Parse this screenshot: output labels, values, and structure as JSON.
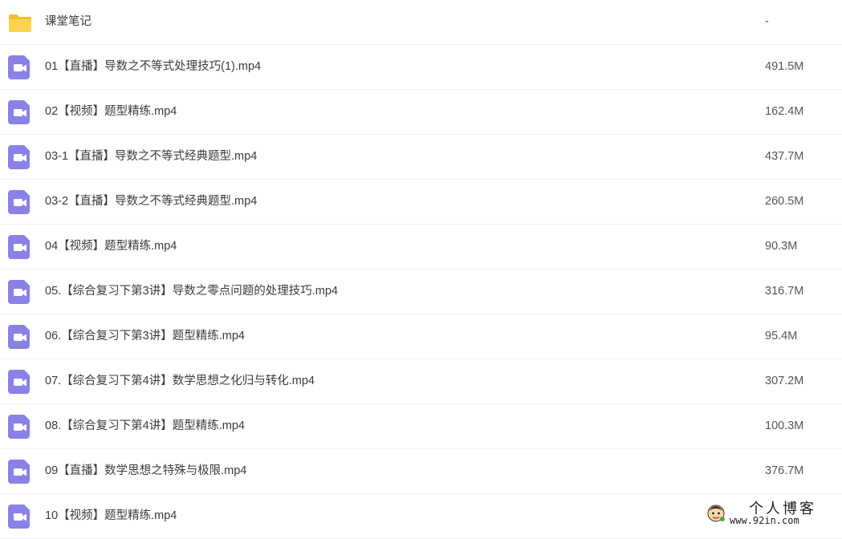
{
  "colors": {
    "folder_icon": "#FFD34F",
    "folder_icon_tab": "#F5BE2E",
    "video_icon": "#8A81E6",
    "row_divider": "#F0F0F2"
  },
  "files": [
    {
      "name": "课堂笔记",
      "size": "-",
      "icon": "folder-icon"
    },
    {
      "name": "01【直播】导数之不等式处理技巧(1).mp4",
      "size": "491.5M",
      "icon": "video-file-icon"
    },
    {
      "name": "02【视频】题型精练.mp4",
      "size": "162.4M",
      "icon": "video-file-icon"
    },
    {
      "name": "03-1【直播】导数之不等式经典题型.mp4",
      "size": "437.7M",
      "icon": "video-file-icon"
    },
    {
      "name": "03-2【直播】导数之不等式经典题型.mp4",
      "size": "260.5M",
      "icon": "video-file-icon"
    },
    {
      "name": "04【视频】题型精练.mp4",
      "size": "90.3M",
      "icon": "video-file-icon"
    },
    {
      "name": "05.【综合复习下第3讲】导数之零点问题的处理技巧.mp4",
      "size": "316.7M",
      "icon": "video-file-icon"
    },
    {
      "name": "06.【综合复习下第3讲】题型精练.mp4",
      "size": "95.4M",
      "icon": "video-file-icon"
    },
    {
      "name": "07.【综合复习下第4讲】数学思想之化归与转化.mp4",
      "size": "307.2M",
      "icon": "video-file-icon"
    },
    {
      "name": "08.【综合复习下第4讲】题型精练.mp4",
      "size": "100.3M",
      "icon": "video-file-icon"
    },
    {
      "name": "09【直播】数学思想之特殊与极限.mp4",
      "size": "376.7M",
      "icon": "video-file-icon"
    },
    {
      "name": "10【视频】题型精练.mp4",
      "size": "",
      "icon": "video-file-icon"
    }
  ],
  "watermark": {
    "title": "个人博客",
    "url": "www.92in.com",
    "icon": "cartoon-face-icon"
  }
}
